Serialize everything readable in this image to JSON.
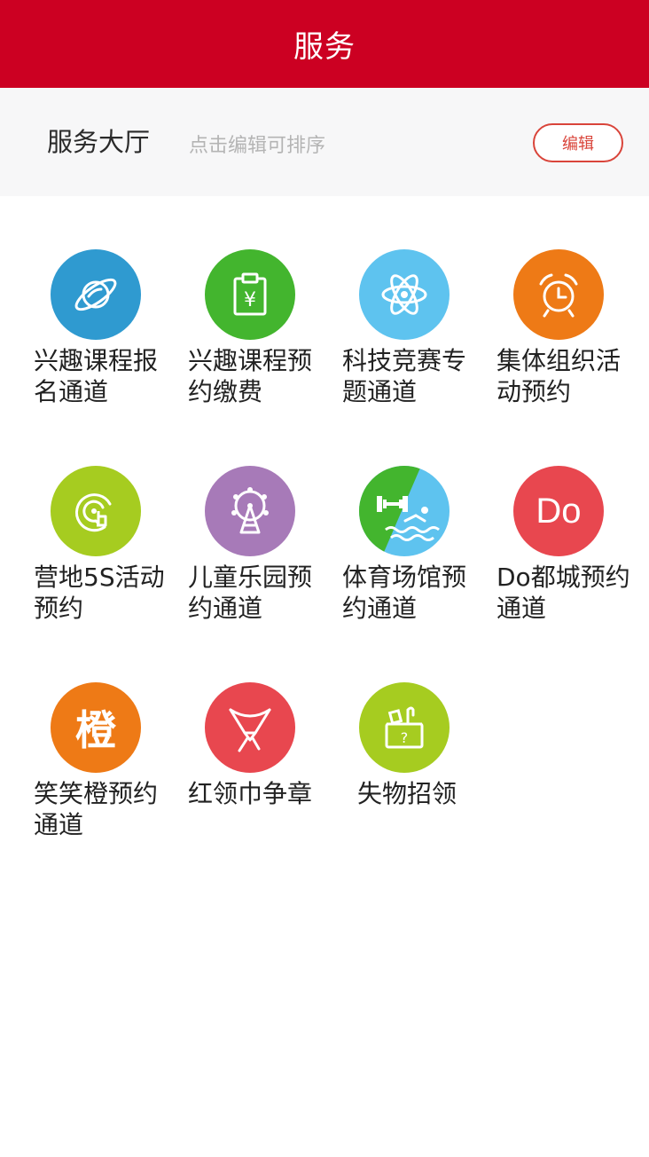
{
  "header": {
    "title": "服务"
  },
  "hall": {
    "title": "服务大厅",
    "hint": "点击编辑可排序",
    "edit_label": "编辑"
  },
  "services": [
    {
      "label": "兴趣课程报名通道",
      "icon": "planet-icon",
      "color": "#2f9ad0"
    },
    {
      "label": "兴趣课程预约缴费",
      "icon": "clipboard-yuan-icon",
      "color": "#43b52e"
    },
    {
      "label": "科技竞赛专题通道",
      "icon": "atom-icon",
      "color": "#5ec3ef"
    },
    {
      "label": "集体组织活动预约",
      "icon": "alarm-clock-icon",
      "color": "#ee7a16"
    },
    {
      "label": "营地5S活动预约",
      "icon": "target-tap-icon",
      "color": "#a6cc20"
    },
    {
      "label": "儿童乐园预约通道",
      "icon": "ferris-wheel-icon",
      "color": "#a77ab8"
    },
    {
      "label": "体育场馆预约通道",
      "icon": "dumbbell-swimmer-icon",
      "color_a": "#43b52e",
      "color_b": "#5ec3ef"
    },
    {
      "label": "Do都城预约通道",
      "icon": "do-text-icon",
      "icon_text": "Do",
      "color": "#e8474f"
    },
    {
      "label": "笑笑橙预约通道",
      "icon": "orange-char-icon",
      "icon_text": "橙",
      "color": "#ee7a16"
    },
    {
      "label": "红领巾争章",
      "icon": "scarf-icon",
      "color": "#e8474f"
    },
    {
      "label": "失物招领",
      "icon": "lost-box-icon",
      "color": "#a6cc20"
    }
  ]
}
